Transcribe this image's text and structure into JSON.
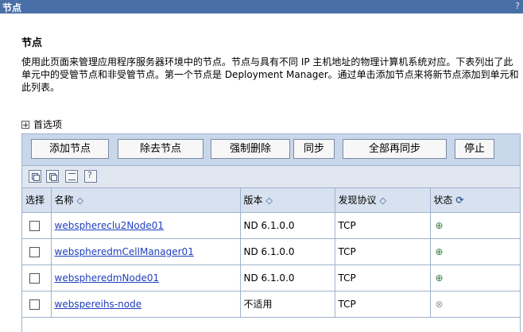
{
  "titlebar": {
    "title": "节点",
    "help": "?"
  },
  "page": {
    "heading": "节点",
    "description": "使用此页面来管理应用程序服务器环境中的节点。节点与具有不同 IP 主机地址的物理计算机系统对应。下表列出了此单元中的受管节点和非受管节点。第一个节点是 Deployment Manager。通过单击添加节点来将新节点添加到单元和此列表。"
  },
  "preferences": {
    "label": "首选项",
    "icon": "plus-box-icon"
  },
  "buttons": {
    "add": "添加节点",
    "remove": "除去节点",
    "force_delete": "强制删除",
    "sync": "同步",
    "full_resync": "全部再同步",
    "stop": "停止"
  },
  "table": {
    "headers": {
      "select": "选择",
      "name": "名称",
      "version": "版本",
      "protocol": "发现协议",
      "status": "状态"
    },
    "rows": [
      {
        "name": "websphereclu2Node01",
        "version": "ND 6.1.0.0",
        "protocol": "TCP",
        "status": "running"
      },
      {
        "name": "webspheredmCellManager01",
        "version": "ND 6.1.0.0",
        "protocol": "TCP",
        "status": "running"
      },
      {
        "name": "webspheredmNode01",
        "version": "ND 6.1.0.0",
        "protocol": "TCP",
        "status": "running"
      },
      {
        "name": "webspereihs-node",
        "version": "不适用",
        "protocol": "TCP",
        "status": "not-applicable"
      }
    ]
  }
}
